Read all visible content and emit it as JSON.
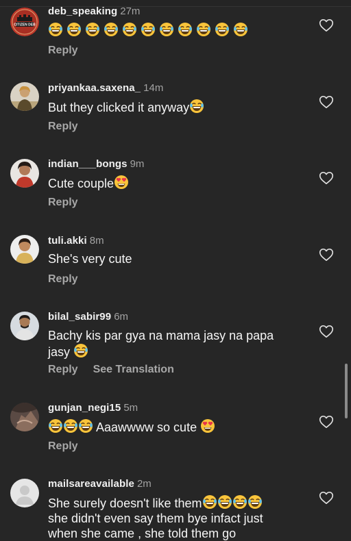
{
  "comments": [
    {
      "user": "deb_speaking",
      "time": "27m",
      "text": "",
      "emoji_before": 11,
      "emoji_after": 0,
      "emoji_type": "laugh",
      "reply": "Reply",
      "avatar": "citizen-deb-logo"
    },
    {
      "user": "priyankaa.saxena_",
      "time": "14m",
      "text": "But they clicked it anyway",
      "emoji_after": 1,
      "emoji_type": "laugh",
      "reply": "Reply",
      "avatar": "user-photo"
    },
    {
      "user": "indian___bongs",
      "time": "9m",
      "text": "Cute couple",
      "emoji_after": 1,
      "emoji_type": "heart-eyes",
      "reply": "Reply",
      "avatar": "user-photo"
    },
    {
      "user": "tuli.akki",
      "time": "8m",
      "text": "She's very cute",
      "reply": "Reply",
      "avatar": "user-photo"
    },
    {
      "user": "bilal_sabir99",
      "time": "6m",
      "text_line1": "Bachy kis par gya na mama jasy na papa",
      "text_line2": "jasy",
      "emoji_after": 1,
      "emoji_type": "laugh",
      "reply": "Reply",
      "translate": "See Translation",
      "avatar": "user-photo"
    },
    {
      "user": "gunjan_negi15",
      "time": "5m",
      "text": "Aaawwww so cute",
      "emoji_before": 3,
      "emoji_after": 1,
      "emoji_type": "heart-eyes",
      "reply": "Reply",
      "avatar": "user-photo"
    },
    {
      "user": "mailsareavailable",
      "time": "2m",
      "text_line1": "She surely doesn't like them",
      "text_line2": "she didn't even say them bye infact just",
      "text_line3": "when she came , she told them go",
      "emoji_after": 4,
      "emoji_type": "laugh",
      "avatar": "default-user-icon"
    }
  ],
  "avatar_badge": "CITIZEN DEB",
  "colors": {
    "background": "#262626",
    "muted": "#a8a8a8",
    "emoji": "#f9c43b"
  }
}
